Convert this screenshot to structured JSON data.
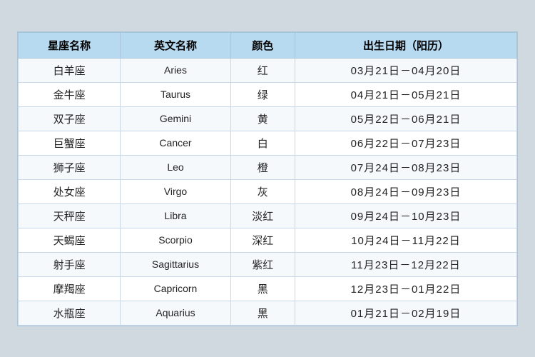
{
  "table": {
    "headers": [
      "星座名称",
      "英文名称",
      "颜色",
      "出生日期（阳历）"
    ],
    "rows": [
      {
        "zh": "白羊座",
        "en": "Aries",
        "color": "红",
        "date": "03月21日－04月20日"
      },
      {
        "zh": "金牛座",
        "en": "Taurus",
        "color": "绿",
        "date": "04月21日－05月21日"
      },
      {
        "zh": "双子座",
        "en": "Gemini",
        "color": "黄",
        "date": "05月22日－06月21日"
      },
      {
        "zh": "巨蟹座",
        "en": "Cancer",
        "color": "白",
        "date": "06月22日－07月23日"
      },
      {
        "zh": "狮子座",
        "en": "Leo",
        "color": "橙",
        "date": "07月24日－08月23日"
      },
      {
        "zh": "处女座",
        "en": "Virgo",
        "color": "灰",
        "date": "08月24日－09月23日"
      },
      {
        "zh": "天秤座",
        "en": "Libra",
        "color": "淡红",
        "date": "09月24日－10月23日"
      },
      {
        "zh": "天蝎座",
        "en": "Scorpio",
        "color": "深红",
        "date": "10月24日－11月22日"
      },
      {
        "zh": "射手座",
        "en": "Sagittarius",
        "color": "紫红",
        "date": "11月23日－12月22日"
      },
      {
        "zh": "摩羯座",
        "en": "Capricorn",
        "color": "黑",
        "date": "12月23日－01月22日"
      },
      {
        "zh": "水瓶座",
        "en": "Aquarius",
        "color": "黑",
        "date": "01月21日－02月19日"
      }
    ]
  }
}
